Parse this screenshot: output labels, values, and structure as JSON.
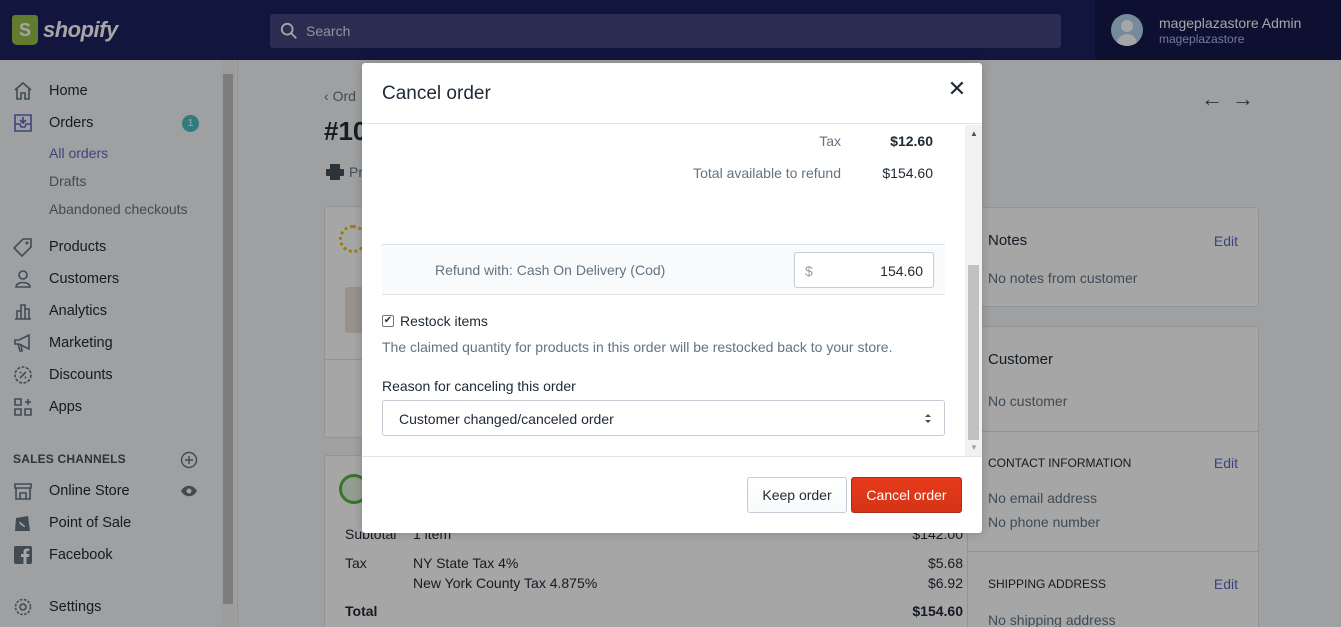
{
  "topbar": {
    "brand": "shopify",
    "search_placeholder": "Search",
    "user_name": "mageplazastore Admin",
    "user_store": "mageplazastore"
  },
  "sidebar": {
    "home": "Home",
    "orders": "Orders",
    "orders_badge": "1",
    "all_orders": "All orders",
    "drafts": "Drafts",
    "abandoned": "Abandoned checkouts",
    "products": "Products",
    "customers": "Customers",
    "analytics": "Analytics",
    "marketing": "Marketing",
    "discounts": "Discounts",
    "apps": "Apps",
    "sales_channels": "SALES CHANNELS",
    "online_store": "Online Store",
    "pos": "Point of Sale",
    "facebook": "Facebook",
    "settings": "Settings"
  },
  "page": {
    "breadcrumb": "Ord",
    "order_number": "#10",
    "print": "Pr",
    "subtotal_label": "Subtotal",
    "subtotal_items": "1 item",
    "subtotal_value": "$142.00",
    "tax_label": "Tax",
    "tax_line1": "NY State Tax 4%",
    "tax_line1_value": "$5.68",
    "tax_line2": "New York County Tax 4.875%",
    "tax_line2_value": "$6.92",
    "total_label": "Total",
    "total_value": "$154.60"
  },
  "right": {
    "notes_title": "Notes",
    "notes_edit": "Edit",
    "notes_text": "No notes from customer",
    "customer_title": "Customer",
    "customer_text": "No customer",
    "contact_title": "CONTACT INFORMATION",
    "contact_edit": "Edit",
    "no_email": "No email address",
    "no_phone": "No phone number",
    "shipping_title": "SHIPPING ADDRESS",
    "shipping_edit": "Edit",
    "no_shipping": "No shipping address"
  },
  "modal": {
    "title": "Cancel order",
    "tax_label": "Tax",
    "tax_value": "$12.60",
    "available_label": "Total available to refund",
    "available_value": "$154.60",
    "refund_label": "Refund with: Cash On Delivery (Cod)",
    "currency": "$",
    "refund_amount": "154.60",
    "restock_label": "Restock items",
    "restock_checked": true,
    "restock_help": "The claimed quantity for products in this order will be restocked back to your store.",
    "reason_label": "Reason for canceling this order",
    "reason_value": "Customer changed/canceled order",
    "keep_button": "Keep order",
    "cancel_button": "Cancel order"
  }
}
